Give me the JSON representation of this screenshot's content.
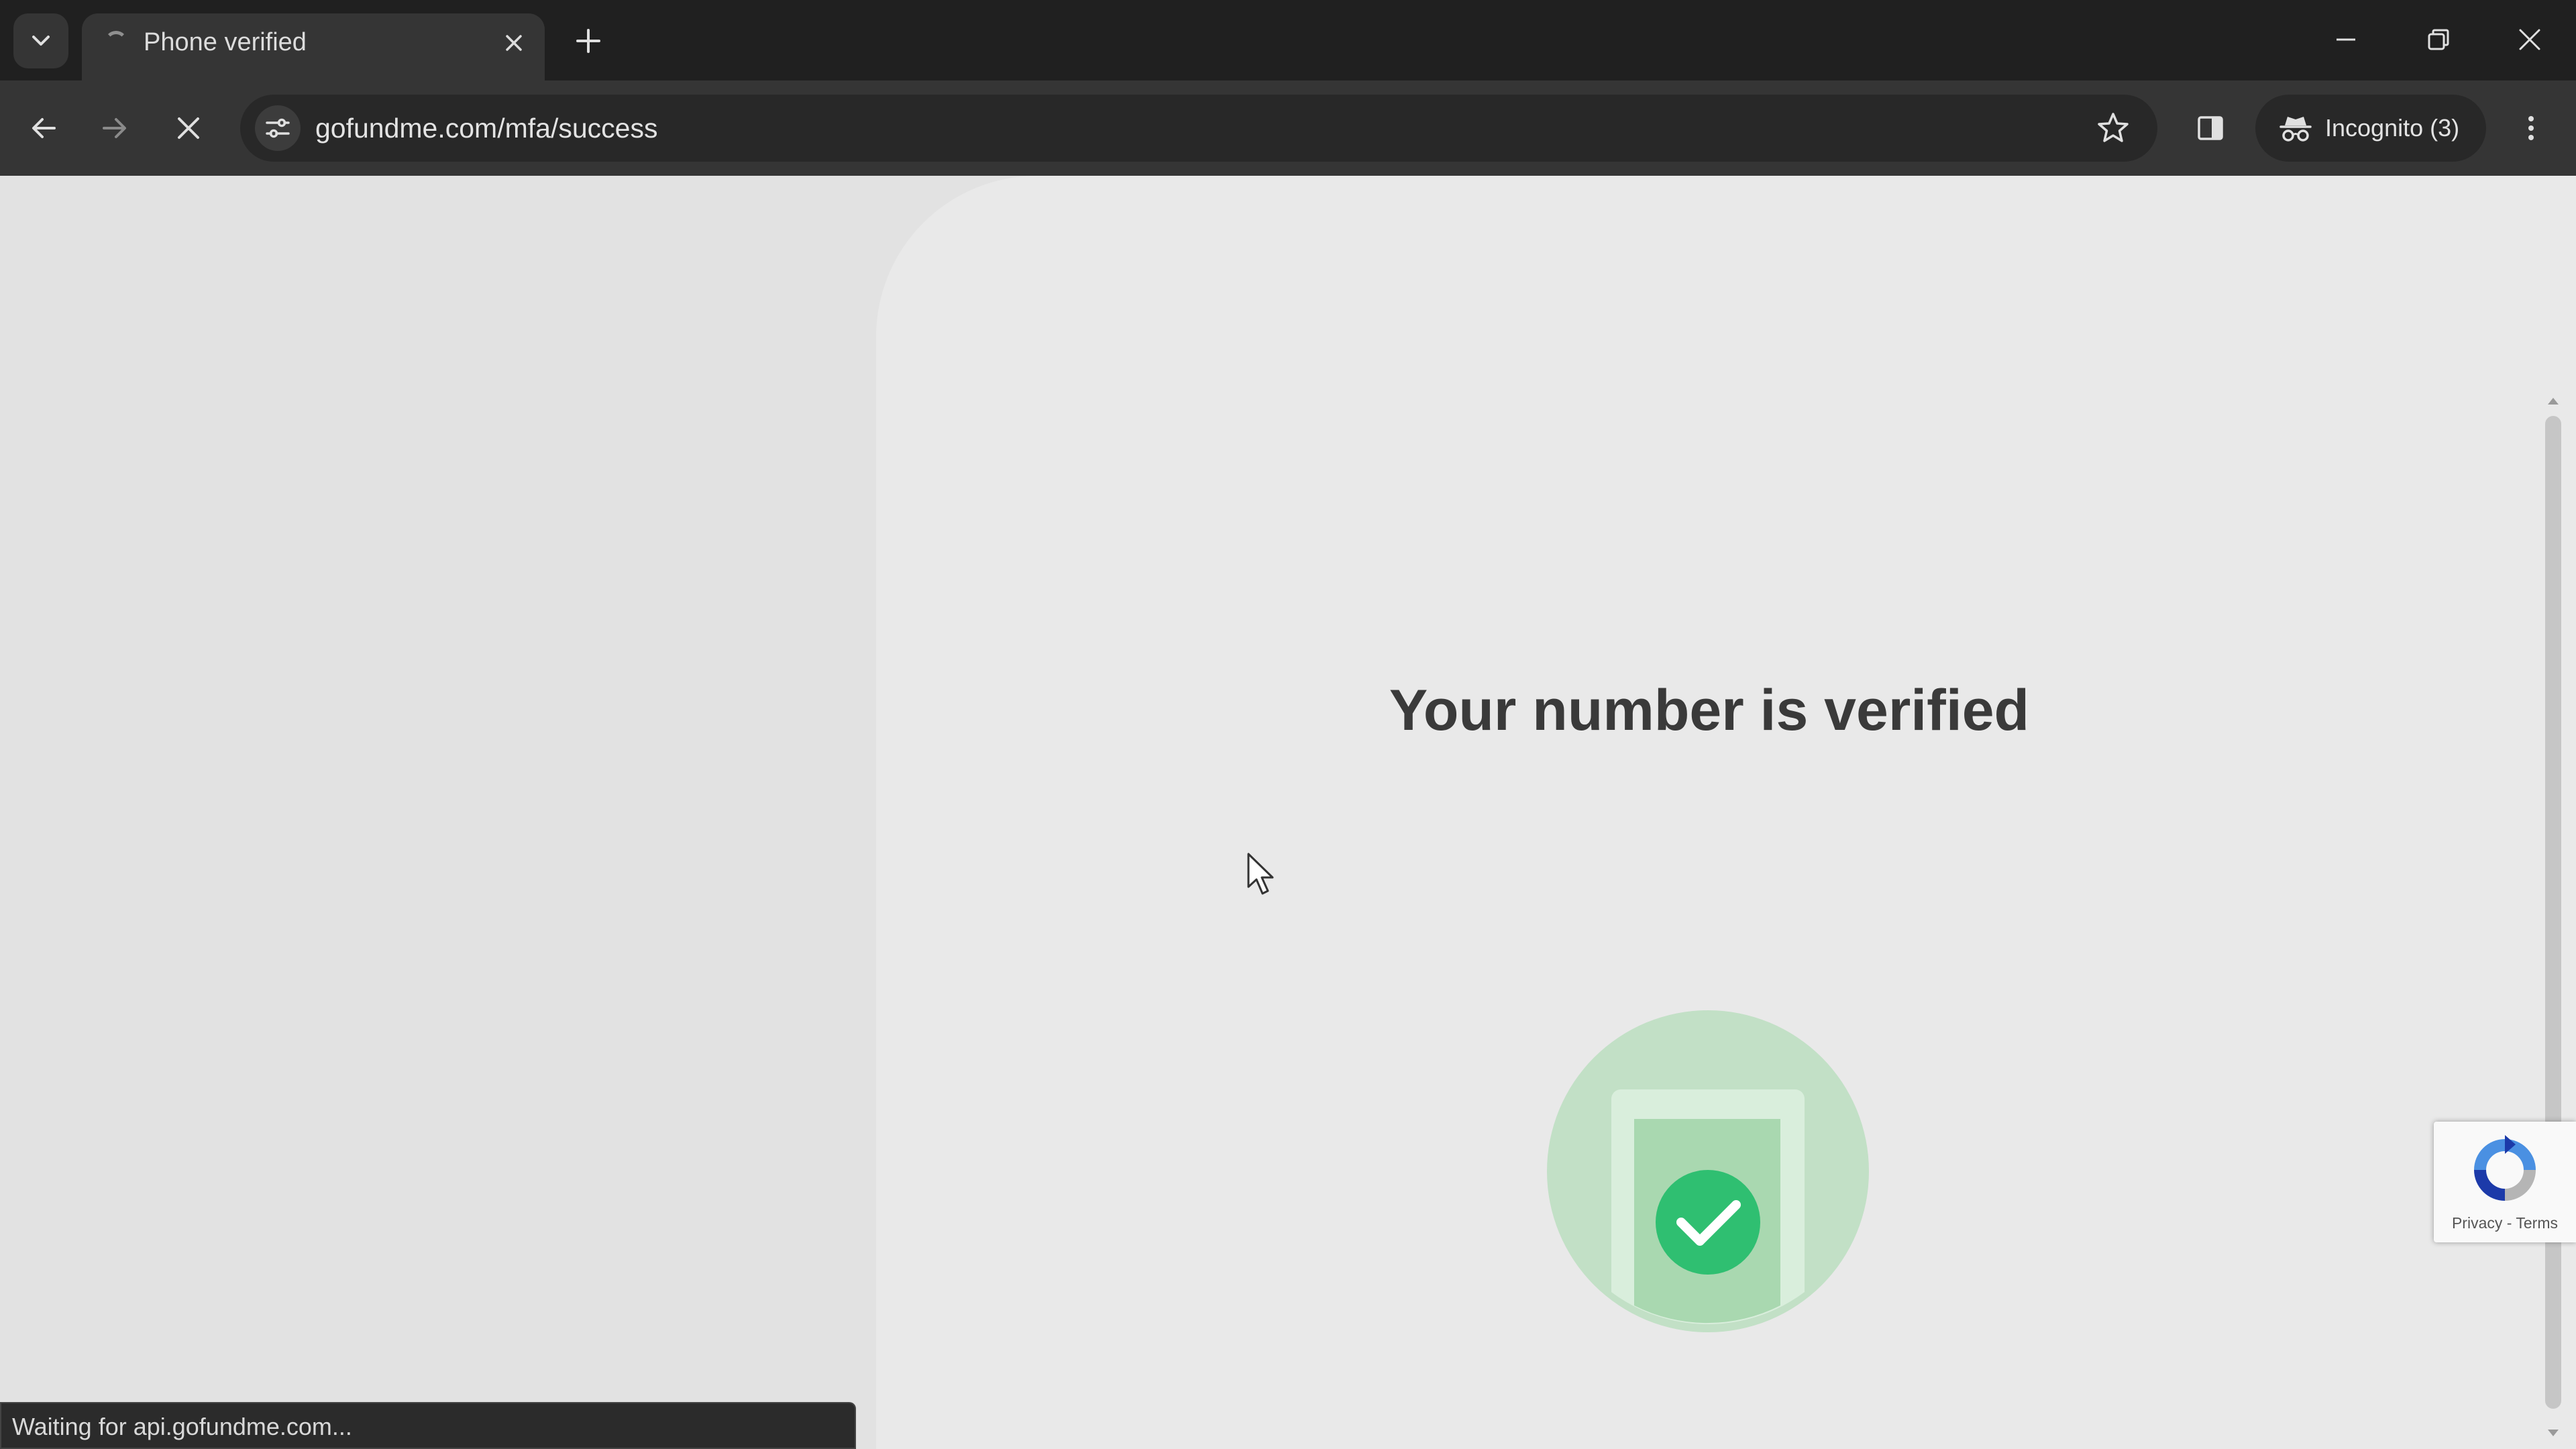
{
  "browser": {
    "tab": {
      "title": "Phone verified"
    },
    "toolbar": {
      "url": "gofundme.com/mfa/success",
      "incognito_label": "Incognito (3)"
    },
    "status_text": "Waiting for api.gofundme.com..."
  },
  "page": {
    "headline": "Your number is verified",
    "colors": {
      "accent_green": "#2fbf71",
      "illustration_circle": "#c2e0c6",
      "illustration_panel": "#a9d8b0"
    }
  },
  "recaptcha": {
    "links": "Privacy - Terms"
  }
}
